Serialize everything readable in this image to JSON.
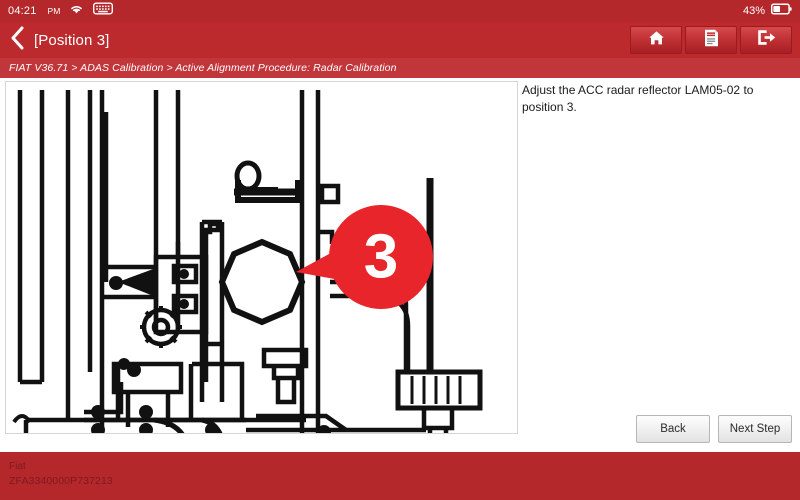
{
  "statusbar": {
    "time": "04:21",
    "ampm": "PM",
    "wifi_icon": "wifi-icon",
    "keyboard_icon": "keyboard-icon",
    "battery_percent": "43%",
    "battery_icon": "battery-icon"
  },
  "header": {
    "back_icon": "chevron-left-icon",
    "title": "[Position 3]",
    "actions": [
      {
        "name": "home-button",
        "icon": "home-icon"
      },
      {
        "name": "report-button",
        "icon": "report-document-icon"
      },
      {
        "name": "exit-button",
        "icon": "exit-arrow-icon"
      }
    ]
  },
  "breadcrumb": {
    "text": "FIAT V36.71 > ADAS Calibration > Active Alignment Procedure: Radar Calibration"
  },
  "main": {
    "instruction": "Adjust the ACC radar reflector LAM05-02 to position 3.",
    "diagram": {
      "type": "line-art-technical-illustration",
      "subject": "ACC radar reflector calibration rig",
      "callout_number": "3",
      "callout_color": "#e8252b"
    },
    "buttons": {
      "back": "Back",
      "next": "Next Step"
    }
  },
  "vehicle": {
    "make": "Fiat",
    "vin": "ZFA3340000P737213"
  },
  "colors": {
    "status_red": "#b4282c",
    "header_red": "#bc2a2e",
    "breadcrumb_red": "#c1363a",
    "callout_red": "#e8252b"
  }
}
